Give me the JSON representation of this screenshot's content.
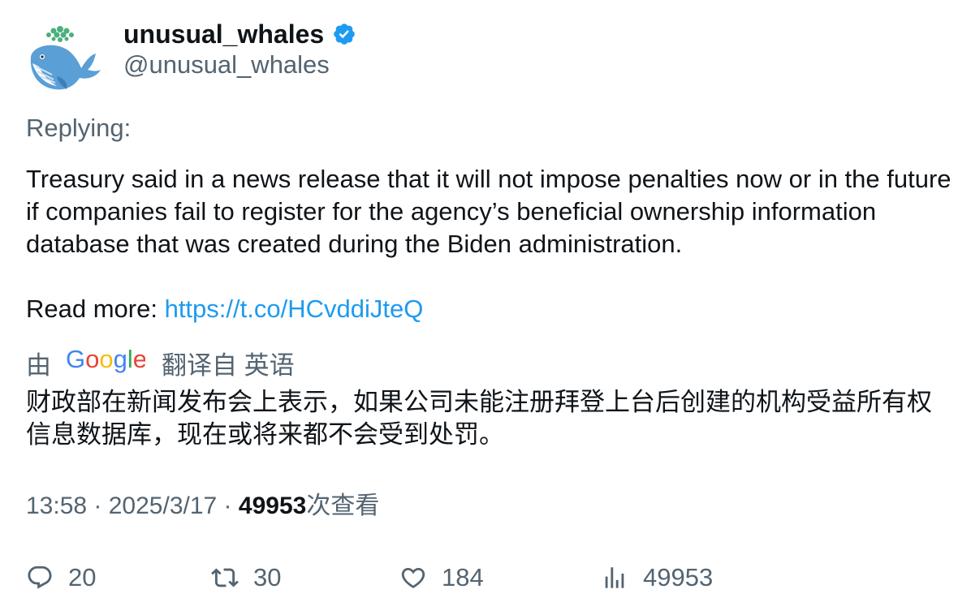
{
  "author": {
    "display_name": "unusual_whales",
    "handle": "@unusual_whales",
    "verified_icon": "verified-badge-icon",
    "avatar_icon": "whale-avatar"
  },
  "tweet": {
    "replying_label": "Replying:",
    "body": "Treasury said in a news release that it will not impose penalties now or in the future if companies fail to register for the agency’s beneficial ownership information database that was created during the Biden administration.",
    "read_more_label": "Read more: ",
    "link_text": "https://t.co/HCvddiJteQ"
  },
  "translation": {
    "by_label": "由",
    "provider": "Google",
    "from_label": "翻译自 英语",
    "text": "财政部在新闻发布会上表示，如果公司未能注册拜登上台后创建的机构受益所有权信息数据库，现在或将来都不会受到处罚。"
  },
  "meta": {
    "time": "13:58",
    "separator": " · ",
    "date": "2025/3/17",
    "views_count": "49953",
    "views_label": "次查看"
  },
  "actions": {
    "reply_count": "20",
    "retweet_count": "30",
    "like_count": "184",
    "views_count": "49953"
  },
  "colors": {
    "link": "#1d9bf0",
    "secondary_text": "#536471",
    "primary_text": "#0f1419",
    "verified": "#1d9bf0"
  }
}
